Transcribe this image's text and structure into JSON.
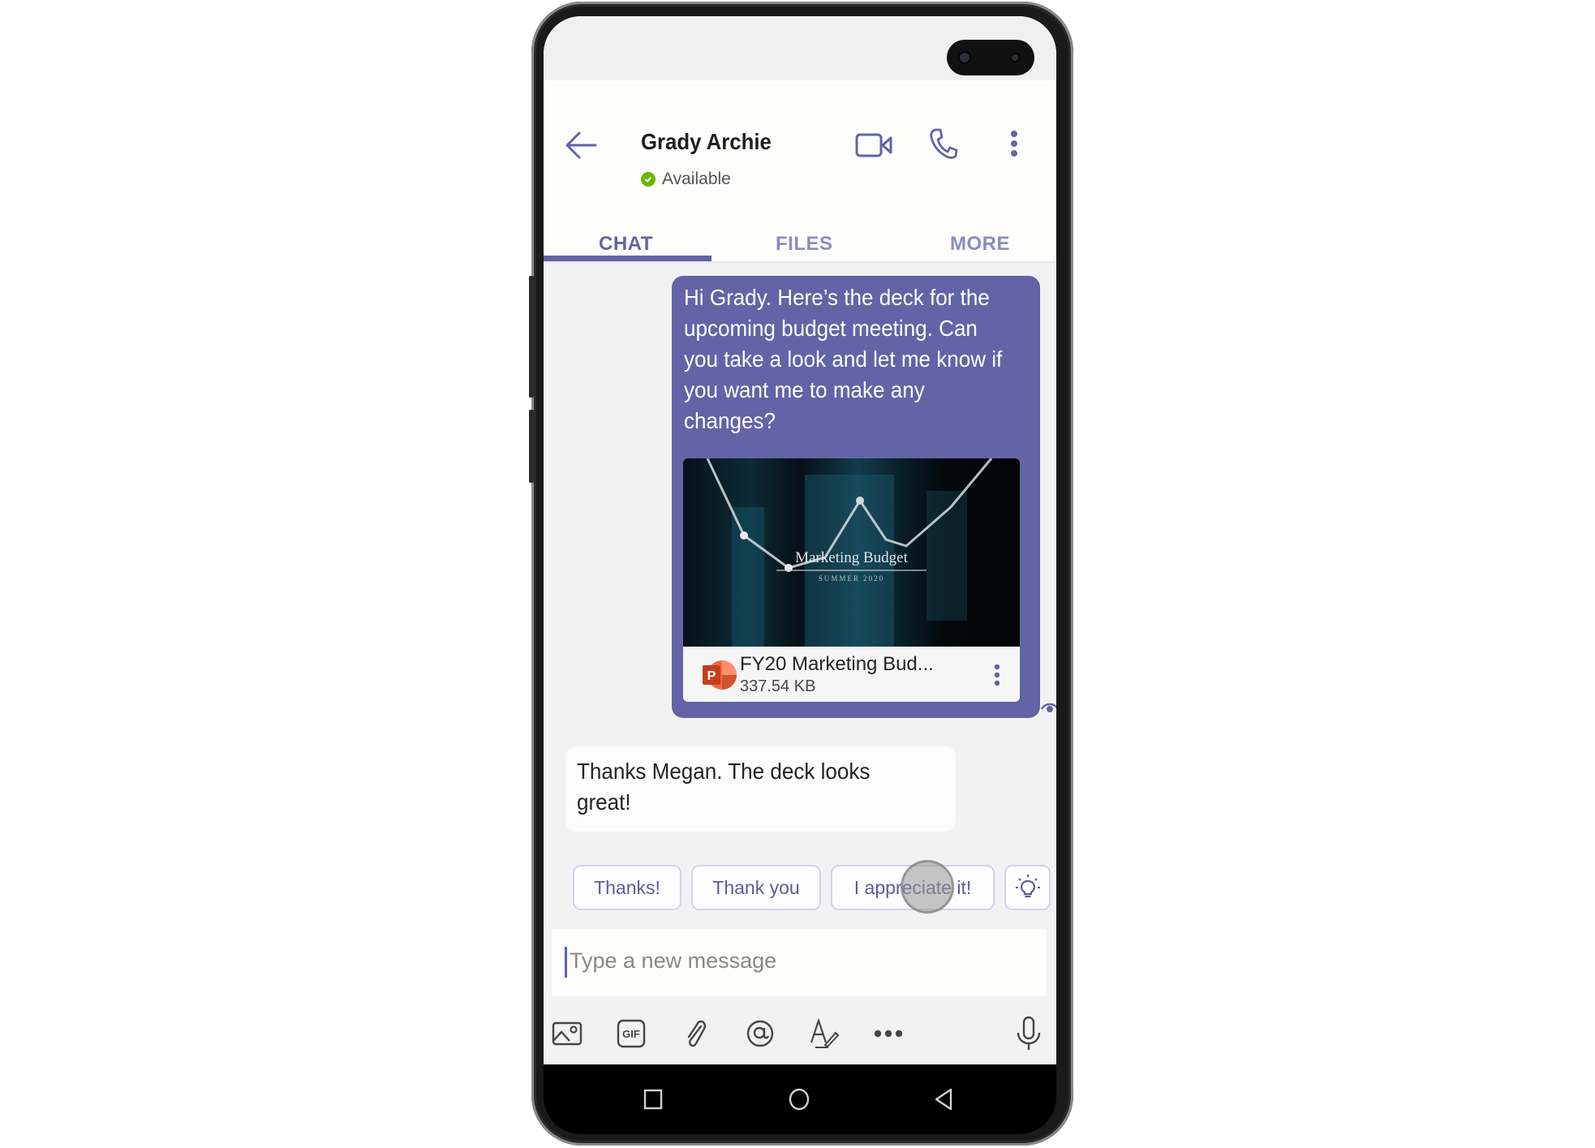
{
  "contact": {
    "name": "Grady Archie",
    "status": "Available",
    "status_color": "#6bb700"
  },
  "header_icons": {
    "back": "arrow-left-icon",
    "video": "video-camera-icon",
    "call": "phone-icon",
    "more": "more-vertical-icon"
  },
  "tabs": [
    {
      "label": "CHAT",
      "active": true
    },
    {
      "label": "FILES",
      "active": false
    },
    {
      "label": "MORE",
      "active": false
    }
  ],
  "messages": [
    {
      "direction": "sent",
      "text": "Hi Grady. Here’s the deck for the upcoming budget meeting. Can you take a look and let me know if you want me to make any changes?",
      "attachment": {
        "preview_title": "Marketing Budget",
        "preview_subtitle": "SUMMER 2020",
        "file_name": "FY20 Marketing Bud...",
        "file_size": "337.54 KB",
        "file_icon": "powerpoint-icon"
      },
      "receipt_icon": "seen-eye-icon"
    },
    {
      "direction": "received",
      "text": "Thanks Megan. The deck looks great!"
    }
  ],
  "suggested_replies": [
    "Thanks!",
    "Thank you",
    "I appreciate it!"
  ],
  "suggestion_icon": "lightbulb-icon",
  "compose": {
    "placeholder": "Type a new message",
    "value": ""
  },
  "toolbar": [
    {
      "name": "image-icon"
    },
    {
      "name": "gif-icon",
      "label": "GIF"
    },
    {
      "name": "attach-icon"
    },
    {
      "name": "mention-icon"
    },
    {
      "name": "format-icon"
    },
    {
      "name": "more-horizontal-icon"
    },
    {
      "name": "microphone-icon"
    }
  ],
  "system_nav": [
    "recents-button",
    "home-button",
    "back-button"
  ],
  "colors": {
    "brand_purple": "#6264a7",
    "chat_background": "#f3f2f2",
    "tab_inactive": "#8a8cc4"
  }
}
